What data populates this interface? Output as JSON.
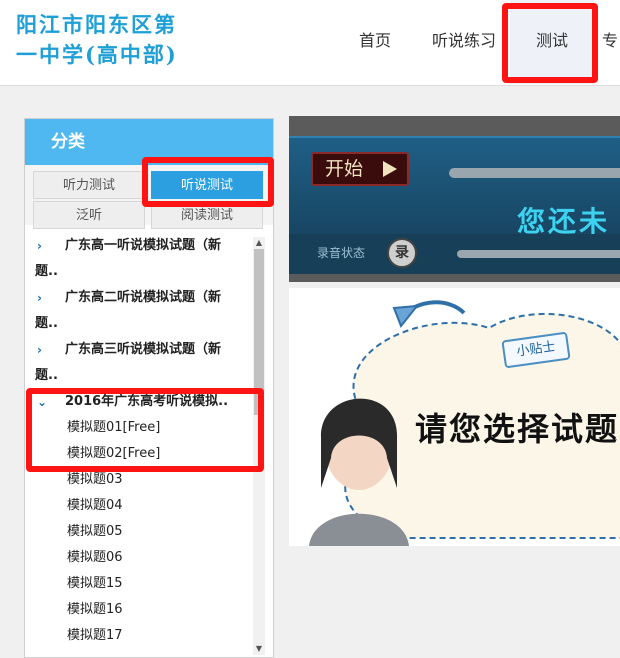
{
  "header": {
    "logo_line1": "阳江市阳东区第",
    "logo_line2": "一中学(高中部)",
    "nav": [
      {
        "label": "首页"
      },
      {
        "label": "听说练习"
      },
      {
        "label": "测试"
      },
      {
        "label": "专"
      }
    ],
    "active_nav": "测试"
  },
  "sidebar": {
    "title": "分类",
    "tabs": [
      {
        "label": "听力测试"
      },
      {
        "label": "听说测试"
      },
      {
        "label": "泛听"
      },
      {
        "label": "阅读测试"
      }
    ],
    "active_tab": "听说测试",
    "tree": [
      {
        "line1": "广东高一听说模拟试题（新",
        "line2": "题.."
      },
      {
        "line1": "广东高二听说模拟试题（新",
        "line2": "题.."
      },
      {
        "line1": "广东高三听说模拟试题（新",
        "line2": "题.."
      },
      {
        "line1": "2016年广东高考听说模拟.."
      }
    ],
    "leaves": [
      "模拟题01[Free]",
      "模拟题02[Free]",
      "模拟题03",
      "模拟题04",
      "模拟题05",
      "模拟题06",
      "模拟题15",
      "模拟题16",
      "模拟题17"
    ]
  },
  "player": {
    "start_label": "开始",
    "banner_text": "您还未",
    "record_label": "录音状态",
    "record_icon_text": "录"
  },
  "tip": {
    "badge": "小贴士",
    "message": "请您选择试题"
  },
  "colors": {
    "accent": "#4fb8f0",
    "active_tab": "#2b9fe0",
    "highlight": "#ff1414",
    "logo": "#1e9fd6"
  }
}
